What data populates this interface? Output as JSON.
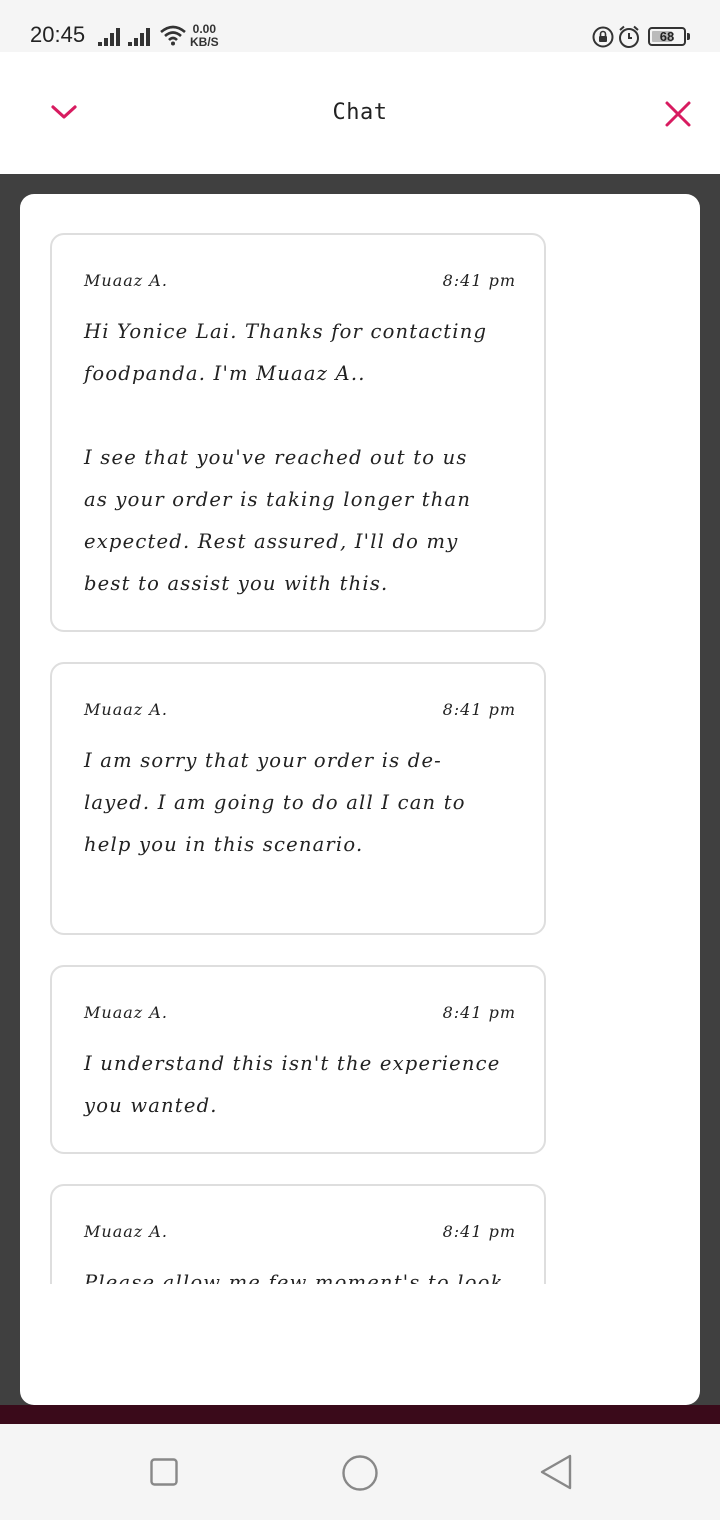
{
  "status_bar": {
    "time": "20:45",
    "net_speed_value": "0.00",
    "net_speed_unit": "KB/S",
    "battery_level": "68"
  },
  "header": {
    "title": "Chat",
    "collapse_icon": "chevron-down-icon",
    "close_icon": "close-icon"
  },
  "colors": {
    "accent": "#d81b60",
    "dim_background": "#404040",
    "accent_strip": "#3a0a1a"
  },
  "messages": [
    {
      "sender": "Muaaz A.",
      "time": "8:41 pm",
      "text": "Hi Yonice Lai. Thanks for contacting\nfoodpanda. I'm Muaaz A..\n\nI see that you've reached out to us\nas your order is taking longer than\nexpected. Rest assured, I'll do my\nbest to assist you with this."
    },
    {
      "sender": "Muaaz A.",
      "time": "8:41 pm",
      "text": "I am sorry that your order is de-\nlayed. I am going to do all I can to\nhelp you in this scenario."
    },
    {
      "sender": "Muaaz A.",
      "time": "8:41 pm",
      "text": "I understand this isn't the experience\nyou wanted."
    },
    {
      "sender": "Muaaz A.",
      "time": "8:41 pm",
      "text": "Please allow me few moment's to look"
    }
  ],
  "nav_bar": {
    "recent_icon": "square-recent-apps-icon",
    "home_icon": "circle-home-icon",
    "back_icon": "triangle-back-icon"
  }
}
